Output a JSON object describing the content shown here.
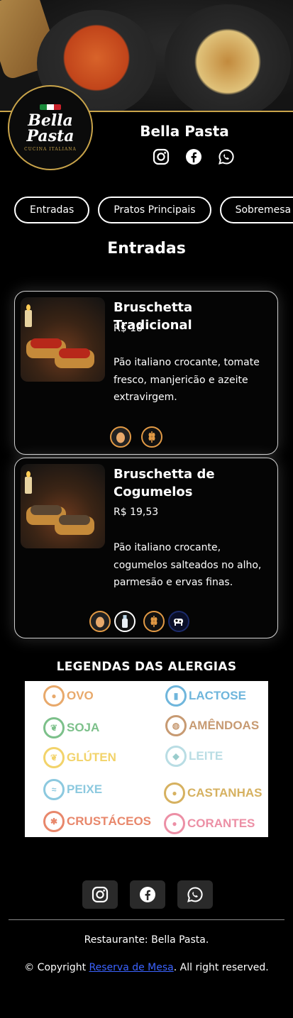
{
  "header": {
    "brand_name": "Bella Pasta",
    "logo_line1": "Bella",
    "logo_line2": "Pasta",
    "logo_tagline": "CUCINA ITALIANA"
  },
  "social_icons": [
    "instagram-icon",
    "facebook-icon",
    "whatsapp-icon"
  ],
  "categories": [
    "Entradas",
    "Pratos Principais",
    "Sobremesa"
  ],
  "section_title": "Entradas",
  "dishes": [
    {
      "name": "Bruschetta Tradicional",
      "price": "R$ 18",
      "description": "Pão italiano crocante, tomate fresco, manjericão e azeite extravirgem.",
      "allergens": [
        "egg-icon",
        "wheat-icon"
      ]
    },
    {
      "name": "Bruschetta de Cogumelos",
      "price": "R$ 19,53",
      "description": "Pão italiano crocante, cogumelos salteados no alho, parmesão e ervas finas.",
      "allergens": [
        "egg-icon",
        "milk-bottle-icon",
        "wheat-icon",
        "cow-icon"
      ]
    }
  ],
  "legend": {
    "title": "LEGENDAS DAS ALERGIAS",
    "items": [
      {
        "label": "OVO",
        "color": "#e8a96b"
      },
      {
        "label": "LACTOSE",
        "color": "#6fb6dc"
      },
      {
        "label": "SOJA",
        "color": "#7cc08a"
      },
      {
        "label": "AMÊNDOAS",
        "color": "#c79a72"
      },
      {
        "label": "GLÚTEN",
        "color": "#f2d36a"
      },
      {
        "label": "LEITE",
        "color": "#b9dde4"
      },
      {
        "label": "PEIXE",
        "color": "#8cc9df"
      },
      {
        "label": "CASTANHAS",
        "color": "#d6b160"
      },
      {
        "label": "CRUSTÁCEOS",
        "color": "#e8876b"
      },
      {
        "label": "CORANTES",
        "color": "#ec8fa5"
      }
    ]
  },
  "footer": {
    "restaurant_text": "Restaurante: Bella Pasta.",
    "copyright_prefix": "© Copyright ",
    "link_text": "Reserva de Mesa",
    "copyright_suffix": ". All right reserved."
  },
  "colors": {
    "accent": "#c9a44a",
    "link": "#3b63ff",
    "background": "#000000"
  }
}
